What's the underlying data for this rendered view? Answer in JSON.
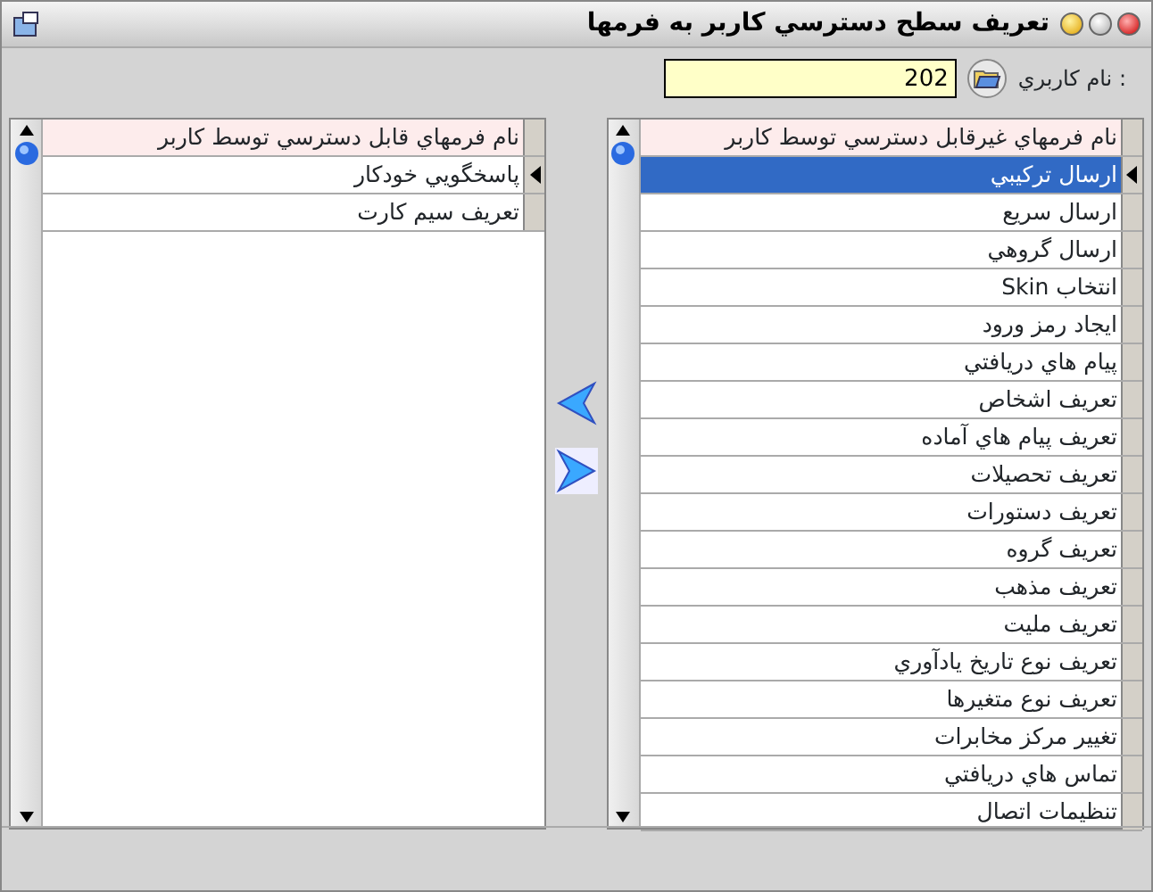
{
  "window": {
    "title": "تعريف سطح دسترسي كاربر به فرمها"
  },
  "username": {
    "label": "نام كاربري :",
    "value": "202"
  },
  "accessible_grid": {
    "header": "نام فرمهاي قابل دسترسي توسط كاربر",
    "rows": [
      {
        "text": "پاسخگويي خودكار",
        "current": true,
        "selected": false
      },
      {
        "text": "تعريف سيم كارت",
        "current": false,
        "selected": false
      }
    ]
  },
  "inaccessible_grid": {
    "header": "نام فرمهاي غيرقابل دسترسي توسط كاربر",
    "rows": [
      {
        "text": "ارسال تركيبي",
        "current": true,
        "selected": true
      },
      {
        "text": "ارسال سريع",
        "current": false,
        "selected": false
      },
      {
        "text": "ارسال گروهي",
        "current": false,
        "selected": false
      },
      {
        "text": "انتخاب Skin",
        "current": false,
        "selected": false
      },
      {
        "text": "ايجاد رمز ورود",
        "current": false,
        "selected": false
      },
      {
        "text": "پيام هاي دريافتي",
        "current": false,
        "selected": false
      },
      {
        "text": "تعريف اشخاص",
        "current": false,
        "selected": false
      },
      {
        "text": "تعريف پيام هاي آماده",
        "current": false,
        "selected": false
      },
      {
        "text": "تعريف تحصيلات",
        "current": false,
        "selected": false
      },
      {
        "text": "تعريف دستورات",
        "current": false,
        "selected": false
      },
      {
        "text": "تعريف گروه",
        "current": false,
        "selected": false
      },
      {
        "text": "تعريف مذهب",
        "current": false,
        "selected": false
      },
      {
        "text": "تعريف مليت",
        "current": false,
        "selected": false
      },
      {
        "text": "تعريف نوع تاريخ يادآوري",
        "current": false,
        "selected": false
      },
      {
        "text": "تعريف نوع متغيرها",
        "current": false,
        "selected": false
      },
      {
        "text": "تغيير مركز مخابرات",
        "current": false,
        "selected": false
      },
      {
        "text": "تماس هاي دريافتي",
        "current": false,
        "selected": false
      },
      {
        "text": "تنظيمات اتصال",
        "current": false,
        "selected": false
      }
    ]
  }
}
